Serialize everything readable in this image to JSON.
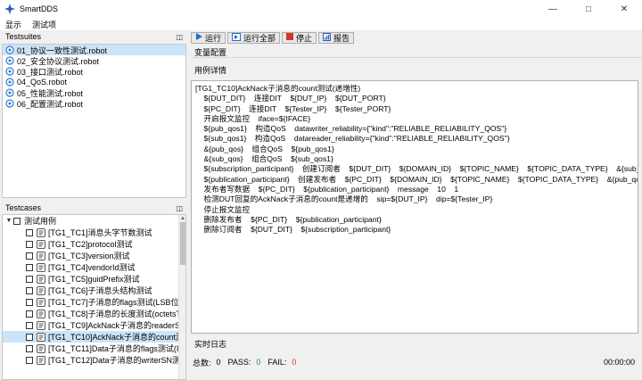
{
  "app": {
    "title": "SmartDDS"
  },
  "menu": [
    "显示",
    "测试项"
  ],
  "testsuites": {
    "title": "Testsuites",
    "items": [
      {
        "label": "01_协议一致性测试.robot",
        "selected": true
      },
      {
        "label": "02_安全协议测试.robot"
      },
      {
        "label": "03_接口测试.robot"
      },
      {
        "label": "04_QoS.robot"
      },
      {
        "label": "05_性能测试.robot"
      },
      {
        "label": "06_配置测试.robot"
      }
    ]
  },
  "testcases": {
    "title": "Testcases",
    "root_label": "测试用例",
    "items": [
      "[TG1_TC1]消息头字节数测试",
      "[TG1_TC2]protocol测试",
      "[TG1_TC3]version测试",
      "[TG1_TC4]vendorId测试",
      "[TG1_TC5]guidPrefix测试",
      "[TG1_TC6]子消息头结构测试",
      "[TG1_TC7]子消息的flags测试(LSB位)",
      "[TG1_TC8]子消息的长度测试(octetsTo...",
      "[TG1_TC9]AckNack子消息的readerSN...",
      "[TG1_TC10]AckNack子消息的count测...",
      "[TG1_TC11]Data子消息的flags测试(Inl...",
      "[TG1_TC12]Data子消息的writerSN测..."
    ],
    "selected_index": 9
  },
  "toolbar": {
    "run": "运行",
    "run_all": "运行全部",
    "stop": "停止",
    "report": "报告"
  },
  "sections": {
    "variables": "变量配置",
    "detail": "用例详情",
    "log": "实时日志"
  },
  "detail_lines": [
    "[TG1_TC10]AckNack子消息的count测试(递增性)",
    "    ${DUT_DIT}    连接DIT    ${DUT_IP}    ${DUT_PORT}",
    "    ${PC_DIT}    连接DIT    ${Tester_IP}    ${Tester_PORT}",
    "    开启报文监控    iface=${IFACE}",
    "    ${pub_qos1}    构造QoS    datawriter_reliability={\"kind\":\"RELIABLE_RELIABILITY_QOS\"}",
    "    ${sub_qos1}    构造QoS    datareader_reliability={\"kind\":\"RELIABLE_RELIABILITY_QOS\"}",
    "    &{pub_qos}    组合QoS    ${pub_qos1}",
    "    &{sub_qos}    组合QoS    ${sub_qos1}",
    "    ${subscription_participant}    创建订阅者    ${DUT_DIT}    ${DOMAIN_ID}    ${TOPIC_NAME}    ${TOPIC_DATA_TYPE}    &{sub_qos}",
    "    ${publication_participant}    创建发布者    ${PC_DIT}    ${DOMAIN_ID}    ${TOPIC_NAME}    ${TOPIC_DATA_TYPE}    &{pub_qos}",
    "    发布者写数据    ${PC_DIT}    ${publication_participant}    message    10    1",
    "    检测DUT回复的AckNack子消息的count是递增的    sip=${DUT_IP}    dip=${Tester_IP}",
    "    停止报文监控",
    "    删除发布者    ${PC_DIT}    ${publication_participant}",
    "    删除订阅者    ${DUT_DIT}    ${subscription_participant}"
  ],
  "status": {
    "total_label": "总数:",
    "total": "0",
    "pass_label": "PASS:",
    "pass": "0",
    "fail_label": "FAIL:",
    "fail": "0",
    "time": "00:00:00"
  },
  "colors": {
    "selection": "#cce4f7",
    "run_icon": "#1e6fd0",
    "stop_icon": "#d9342b",
    "pass": "#2e8b57",
    "fail": "#d9342b"
  }
}
